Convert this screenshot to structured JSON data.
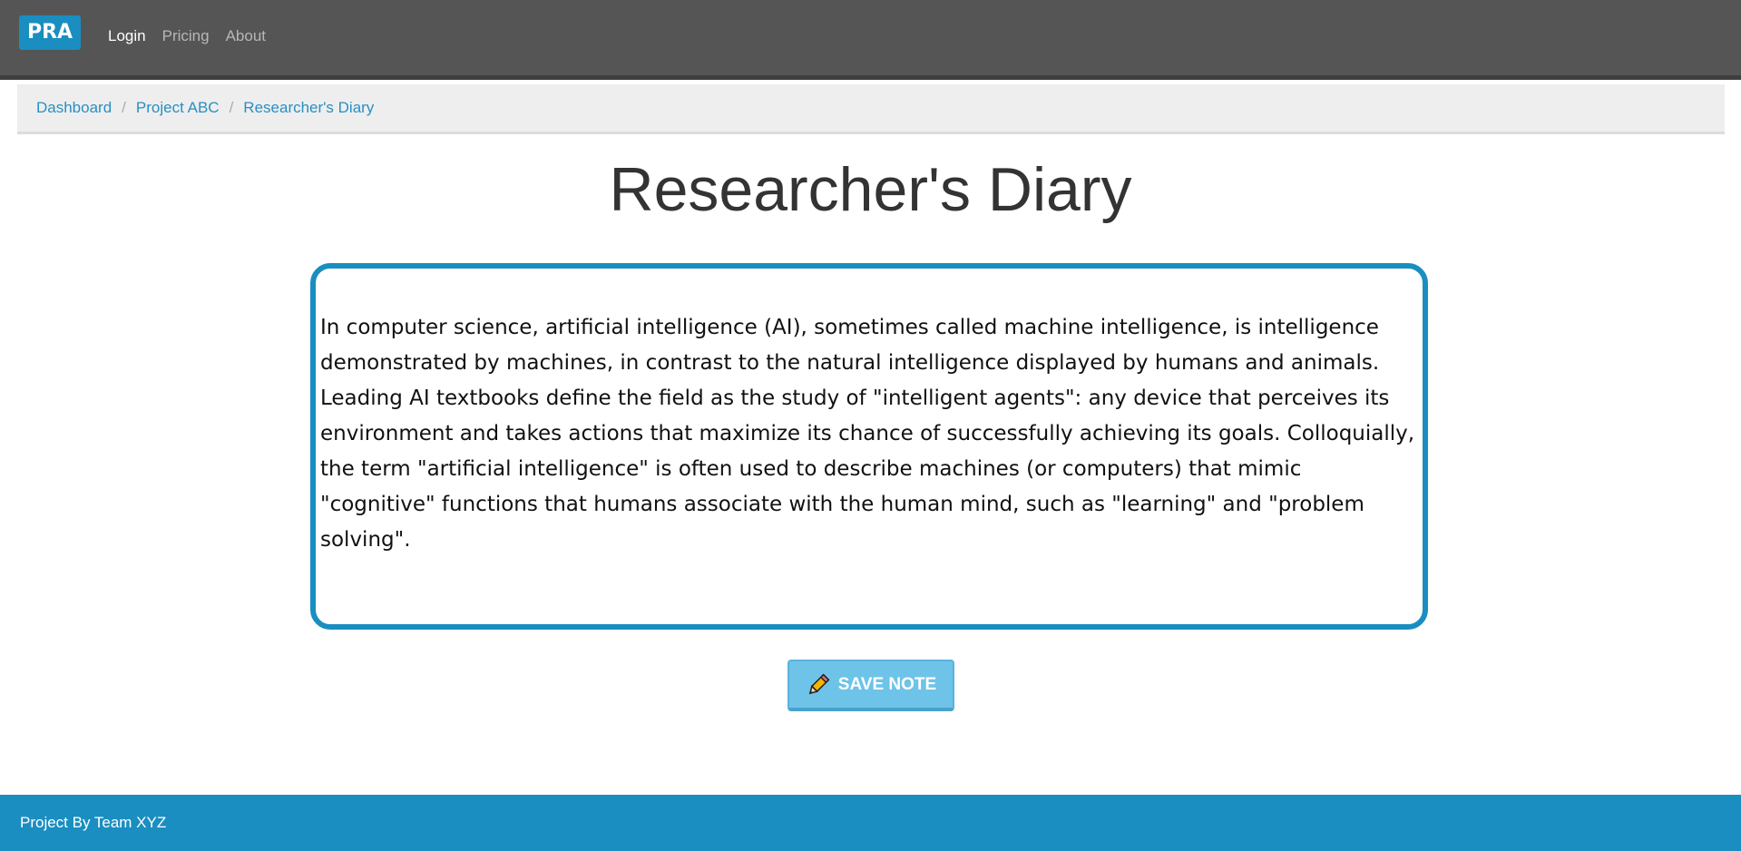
{
  "navbar": {
    "brand": "PRA",
    "links": [
      {
        "label": "Login",
        "active": true
      },
      {
        "label": "Pricing",
        "active": false
      },
      {
        "label": "About",
        "active": false
      }
    ]
  },
  "breadcrumb": {
    "items": [
      "Dashboard",
      "Project ABC",
      "Researcher's Diary"
    ],
    "separator": "/"
  },
  "page": {
    "title": "Researcher's Diary"
  },
  "note": {
    "content": "In computer science, artificial intelligence (AI), sometimes called machine intelligence, is intelligence demonstrated by machines, in contrast to the natural intelligence displayed by humans and animals. Leading AI textbooks define the field as the study of \"intelligent agents\": any device that perceives its environment and takes actions that maximize its chance of successfully achieving its goals. Colloquially, the term \"artificial intelligence\" is often used to describe machines (or computers) that mimic \"cognitive\" functions that humans associate with the human mind, such as \"learning\" and \"problem solving\"."
  },
  "actions": {
    "save_label": "SAVE NOTE",
    "save_icon": "pencil-icon"
  },
  "footer": {
    "text": "Project By Team XYZ"
  },
  "colors": {
    "navbar": "#555555",
    "brand": "#1a8ec0",
    "link": "#2a8fc1",
    "save_button": "#6ec3e8",
    "footer": "#1a8ec0"
  }
}
